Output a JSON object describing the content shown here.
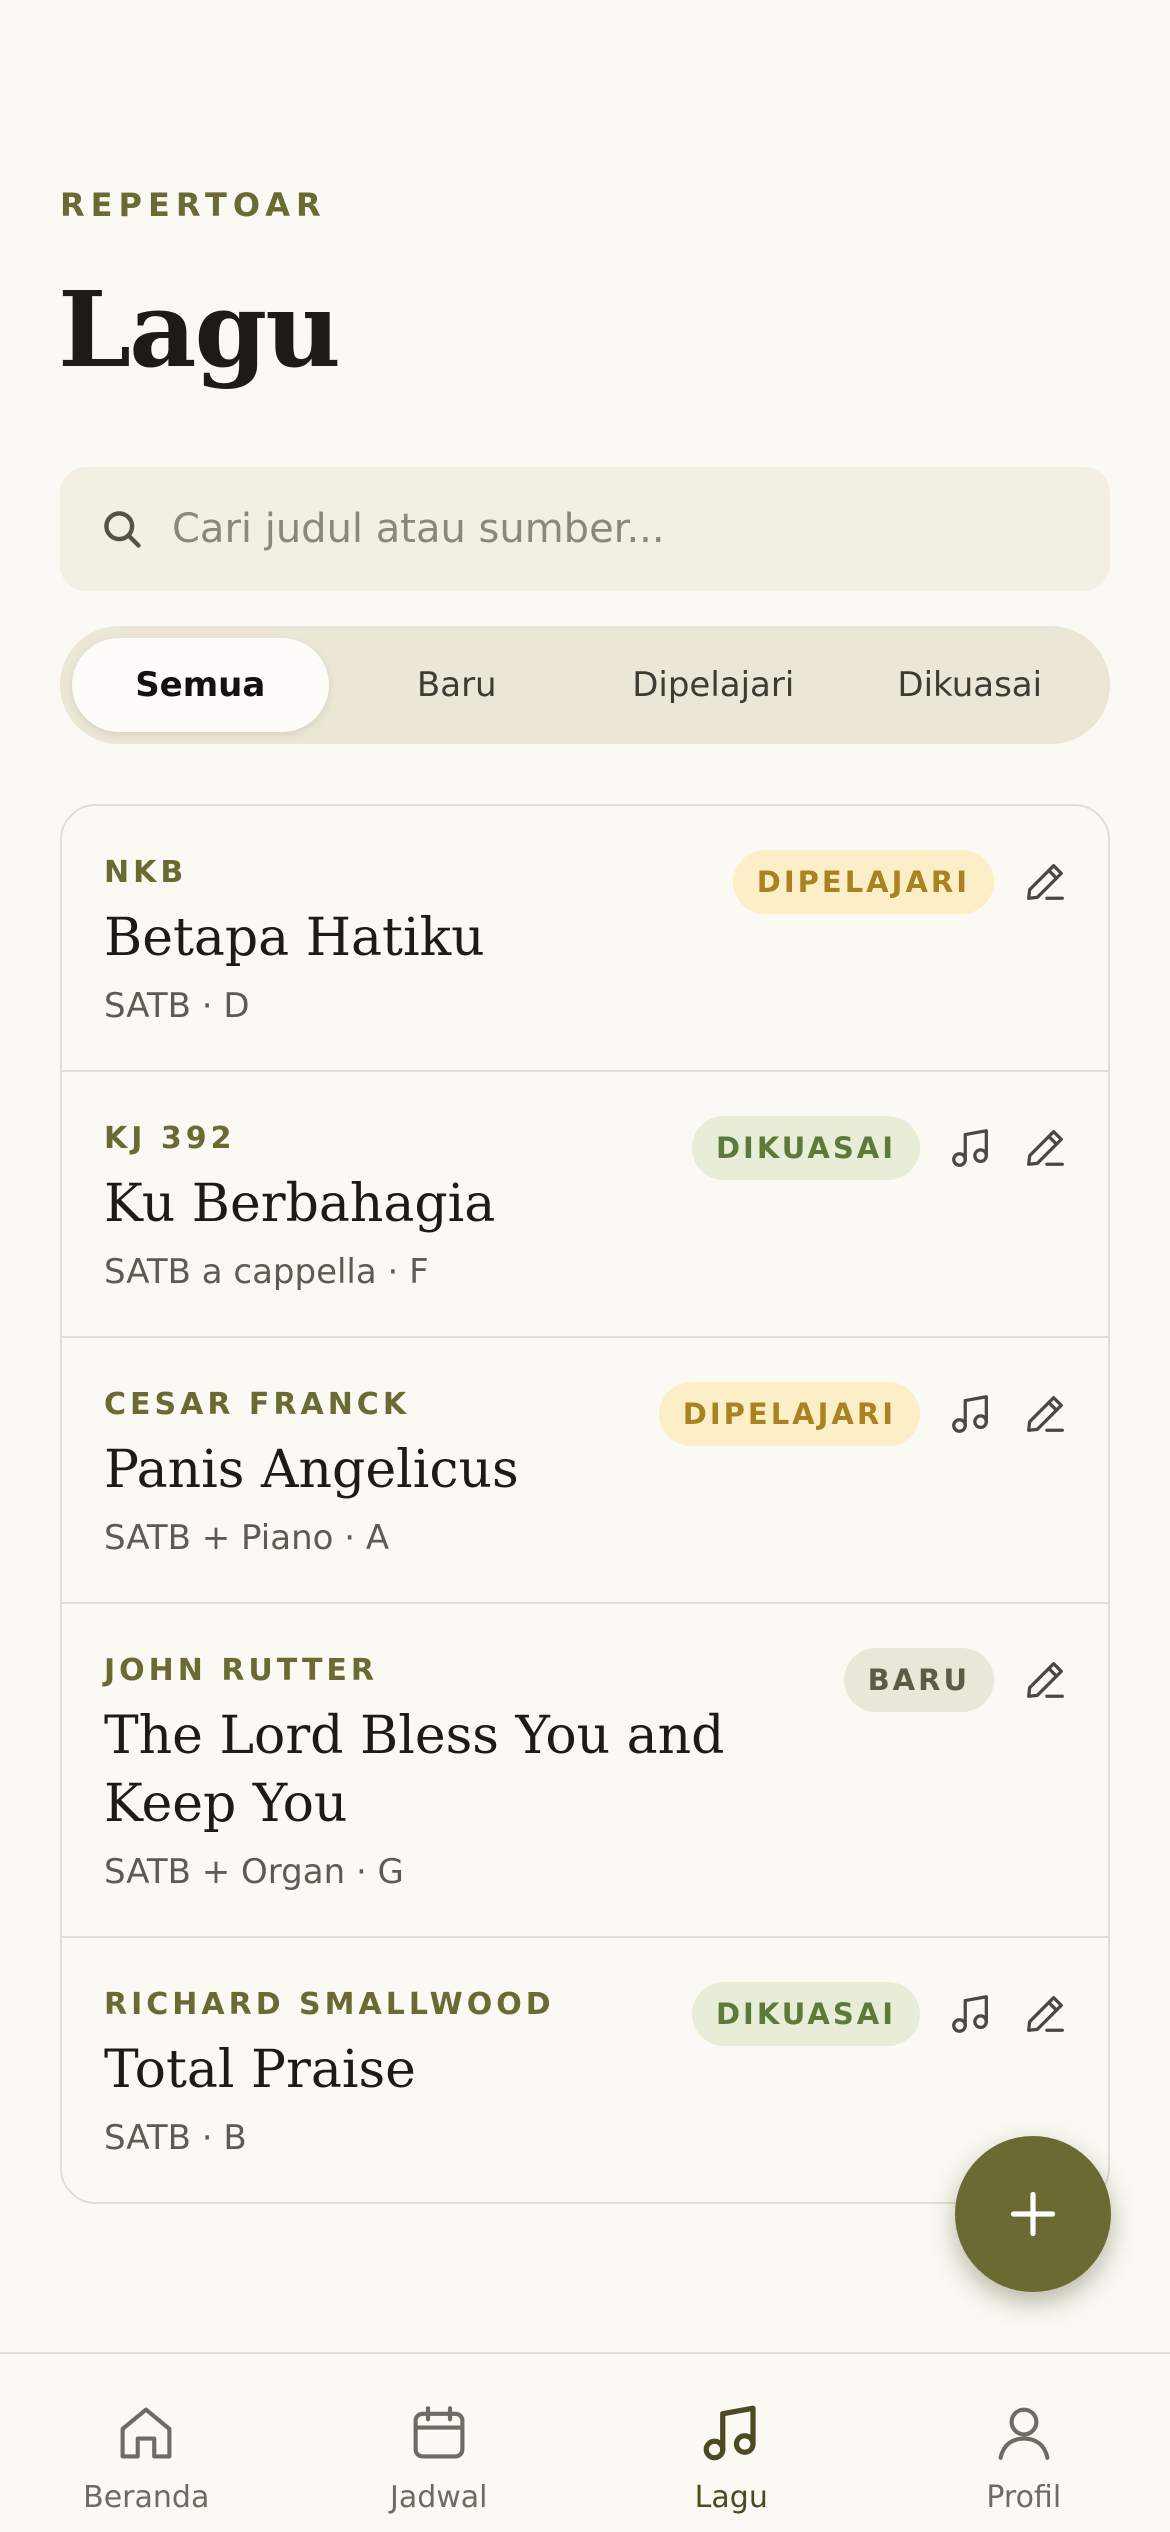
{
  "header": {
    "eyebrow": "REPERTOAR",
    "title": "Lagu"
  },
  "search": {
    "placeholder": "Cari judul atau sumber...",
    "value": ""
  },
  "filters": [
    {
      "label": "Semua",
      "active": true
    },
    {
      "label": "Baru",
      "active": false
    },
    {
      "label": "Dipelajari",
      "active": false
    },
    {
      "label": "Dikuasai",
      "active": false
    }
  ],
  "songs": [
    {
      "source": "NKB",
      "title": "Betapa Hatiku",
      "meta": "SATB · D",
      "status": "DIPELAJARI",
      "has_audio": false
    },
    {
      "source": "KJ 392",
      "title": "Ku Berbahagia",
      "meta": "SATB a cappella · F",
      "status": "DIKUASAI",
      "has_audio": true
    },
    {
      "source": "CESAR FRANCK",
      "title": "Panis Angelicus",
      "meta": "SATB + Piano · A",
      "status": "DIPELAJARI",
      "has_audio": true
    },
    {
      "source": "JOHN RUTTER",
      "title": "The Lord Bless You and Keep You",
      "meta": "SATB + Organ · G",
      "status": "BARU",
      "has_audio": false
    },
    {
      "source": "RICHARD SMALLWOOD",
      "title": "Total Praise",
      "meta": "SATB · B",
      "status": "DIKUASAI",
      "has_audio": true
    }
  ],
  "tabs": [
    {
      "label": "Beranda",
      "icon": "home-icon",
      "active": false
    },
    {
      "label": "Jadwal",
      "icon": "calendar-icon",
      "active": false
    },
    {
      "label": "Lagu",
      "icon": "music-note-icon",
      "active": true
    },
    {
      "label": "Profil",
      "icon": "user-icon",
      "active": false
    }
  ],
  "colors": {
    "accent": "#6b6a33",
    "background": "#fbf9f3",
    "badge_learning_bg": "#fcefc8",
    "badge_mastered_bg": "#e8edd8",
    "badge_new_bg": "#ebe7d8"
  }
}
